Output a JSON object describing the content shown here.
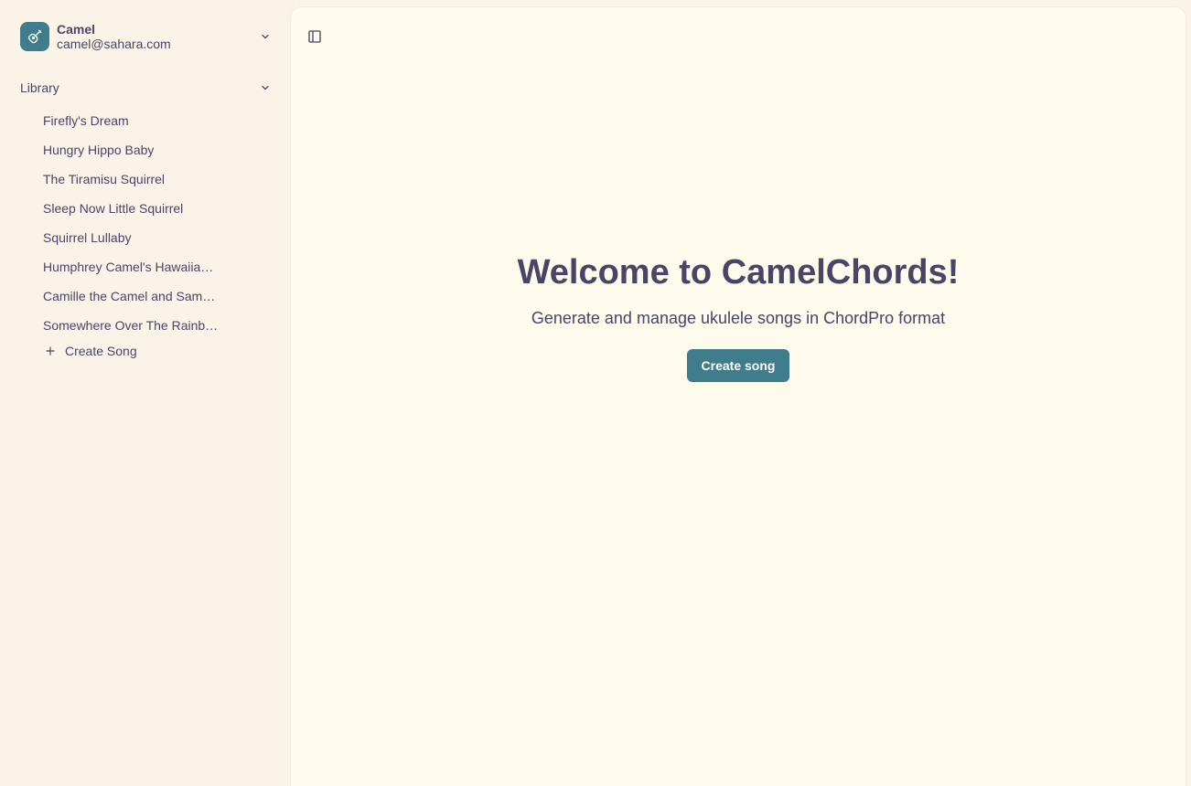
{
  "account": {
    "name": "Camel",
    "email": "camel@sahara.com",
    "avatar_icon": "guitar-icon"
  },
  "sidebar": {
    "library_label": "Library",
    "songs": [
      {
        "label": "Firefly's Dream"
      },
      {
        "label": "Hungry Hippo Baby"
      },
      {
        "label": "The Tiramisu Squirrel"
      },
      {
        "label": "Sleep Now Little Squirrel"
      },
      {
        "label": "Squirrel Lullaby"
      },
      {
        "label": "Humphrey Camel's Hawaiian …"
      },
      {
        "label": "Camille the Camel and Sam…"
      },
      {
        "label": "Somewhere Over The Rainb…"
      }
    ],
    "create_song_label": "Create Song"
  },
  "main": {
    "title": "Welcome to CamelChords!",
    "subtitle": "Generate and manage ukulele songs in ChordPro format",
    "cta_label": "Create song"
  },
  "colors": {
    "accent": "#3f7c8c",
    "text": "#4a4466",
    "sidebar_bg": "#faf4e8",
    "main_bg": "#fefaec"
  }
}
